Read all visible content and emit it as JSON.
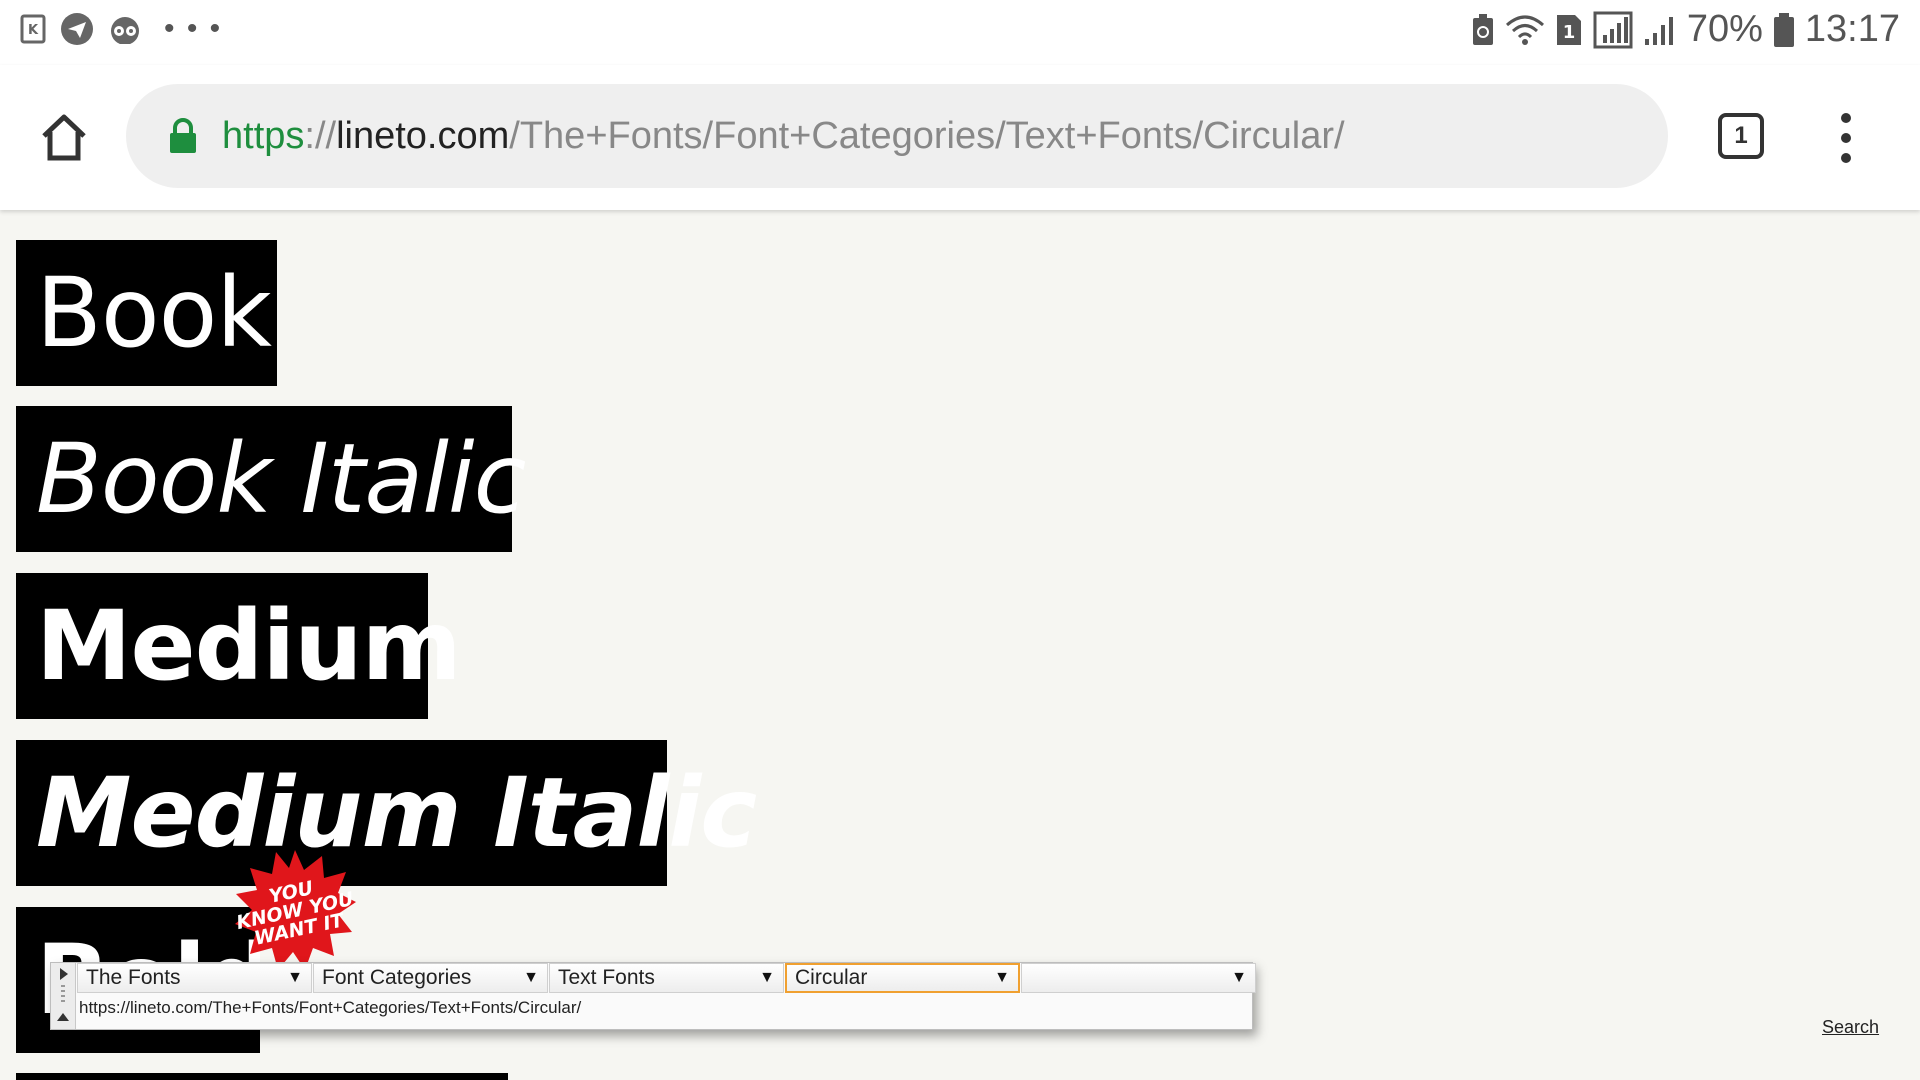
{
  "status_bar": {
    "left_icons": [
      "kindle-icon",
      "telegram-icon",
      "tripadvisor-icon"
    ],
    "more": "• • •",
    "right_icons": [
      "recycle-battery-icon",
      "wifi-icon",
      "sim-1-icon",
      "signal-icon",
      "signal-bars-icon",
      "battery-icon"
    ],
    "sim_label": "1",
    "battery_percent": "70%",
    "time": "13:17"
  },
  "browser": {
    "url_scheme": "https",
    "url_sep": "://",
    "url_host": "lineto.com",
    "url_path": "/The+Fonts/Font+Categories/Text+Fonts/Circular/",
    "tab_count": "1",
    "accent_secure": "#1e8e3e"
  },
  "page": {
    "styles": [
      "Book",
      "Book Italic",
      "Medium",
      "Medium Italic",
      "Bold"
    ],
    "sticker": {
      "line1": "YOU",
      "line2": "KNOW YOU",
      "line3": "WANT IT",
      "color": "#e0161b"
    },
    "search_link": "Search"
  },
  "navigator": {
    "selects": [
      {
        "label": "The Fonts",
        "arrow": "▼"
      },
      {
        "label": "Font Categories",
        "arrow": "▼"
      },
      {
        "label": "Text Fonts",
        "arrow": "▼"
      },
      {
        "label": "Circular",
        "arrow": "▼"
      },
      {
        "label": "",
        "arrow": "▼"
      }
    ],
    "url": "https://lineto.com/The+Fonts/Font+Categories/Text+Fonts/Circular/",
    "active_color": "#f0a030"
  }
}
